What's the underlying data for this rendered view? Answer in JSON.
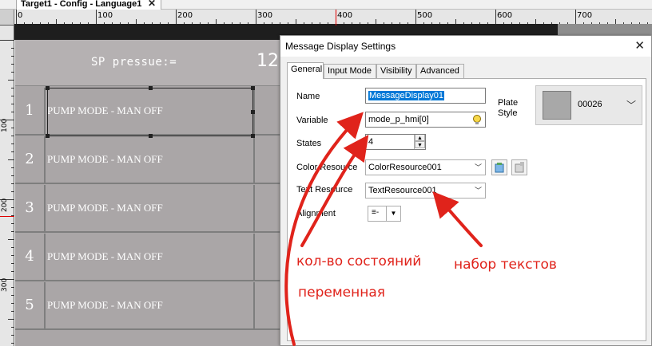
{
  "document_tab": {
    "title": "Target1 - Config - Language1",
    "close": "✕"
  },
  "ruler": {
    "top_labels": [
      "0",
      "100",
      "200",
      "300",
      "400",
      "500",
      "600",
      "700"
    ],
    "left_labels": [
      "100",
      "200",
      "300"
    ]
  },
  "screen": {
    "header_title": "SP pressue:=",
    "header_extra": "12",
    "rows": [
      {
        "num": "1",
        "text": "PUMP MODE - MAN OFF"
      },
      {
        "num": "2",
        "text": "PUMP MODE - MAN OFF"
      },
      {
        "num": "3",
        "text": "PUMP MODE - MAN OFF"
      },
      {
        "num": "4",
        "text": "PUMP MODE - MAN OFF"
      },
      {
        "num": "5",
        "text": "PUMP MODE - MAN OFF"
      }
    ]
  },
  "dialog": {
    "title": "Message Display Settings",
    "close": "✕",
    "tabs": [
      "General",
      "Input Mode",
      "Visibility",
      "Advanced"
    ],
    "fields": {
      "name_label": "Name",
      "name_value": "MessageDisplay01",
      "variable_label": "Variable",
      "variable_value": "mode_p_hmi[0]",
      "states_label": "States",
      "states_value": "4",
      "color_resource_label": "Color Resource",
      "color_resource_value": "ColorResource001",
      "text_resource_label": "Text Resource",
      "text_resource_value": "TextResource001",
      "alignment_label": "Alignment",
      "alignment_glyph": "≡-"
    },
    "plate": {
      "label_line1": "Plate",
      "label_line2": "Style",
      "value": "00026"
    }
  },
  "annotations": {
    "states_count": "кол-во состояний",
    "text_set": "набор текстов",
    "variable": "переменная"
  },
  "colors": {
    "annotation_red": "#e0231b",
    "selection_blue": "#0078d7",
    "screen_gray": "#aaa6a7",
    "canvas_dark": "#3b3b3b"
  }
}
